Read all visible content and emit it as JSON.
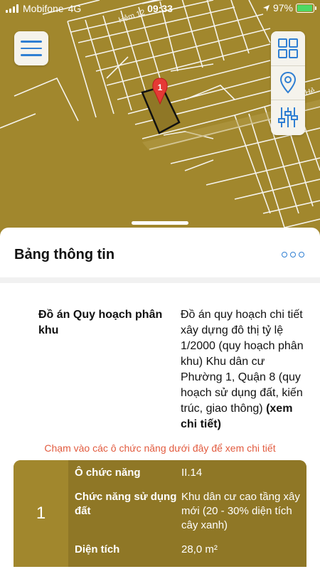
{
  "status_bar": {
    "carrier": "Mobifone",
    "network": "4G",
    "time": "09:33",
    "battery": "97%",
    "battery_level": 0.97
  },
  "map": {
    "road_label_top": "Hẻm 12",
    "road_label_right": "Hẻ",
    "marker_label": "1",
    "colors": {
      "land": "#a1872d",
      "lines": "#f5f3ec",
      "selected": "#8f7726"
    }
  },
  "panel": {
    "title": "Bảng thông tin",
    "plan": {
      "label": "Đồ án Quy hoạch phân khu",
      "value": "Đồ án quy hoạch chi tiết xây dựng đô thị tỷ lệ 1/2000 (quy hoạch phân khu) Khu dân cư Phường 1, Quận 8 (quy hoạch sử dụng đất, kiến trúc, giao thông)",
      "link": "(xem chi tiết)"
    },
    "hint": "Chạm vào các ô chức năng dưới đây để xem chi tiết",
    "card": {
      "index": "1",
      "rows": [
        {
          "key": "Ô chức năng",
          "value": "II.14"
        },
        {
          "key": "Chức năng sử dụng đất",
          "value": "Khu dân cư cao tầng xây mới (20 - 30% diện tích cây xanh)"
        },
        {
          "key": "Diện tích",
          "value": "28,0 m²"
        }
      ]
    }
  },
  "colors": {
    "accent": "#2f7fd3",
    "hint": "#e25b3f"
  }
}
